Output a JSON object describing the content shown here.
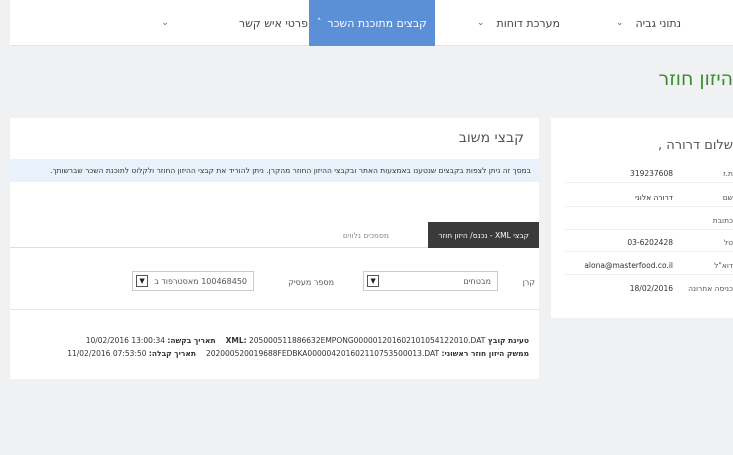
{
  "nav": {
    "items": [
      {
        "label": "נתוני גביה"
      },
      {
        "label": "מערכת דוחות"
      },
      {
        "label": "קבצים מתוכנת השכר"
      },
      {
        "label": "פרטי איש קשר"
      }
    ]
  },
  "page": {
    "title": "היזון חוזר"
  },
  "main": {
    "title": "קבצי משוב",
    "notice": "במסך זה ניתן לצפות בקבצים שנטענו באמצעות האתר ובקבצי ההיזון החוזר מהקרן. ניתן להוריד את קבצי ההיזון החוזר ולקלוט לתוכנת השכר שברשותך.",
    "tabs": {
      "active": "קבצי XML - נכנס/ היזון חוזר",
      "inactive": "מסמכים נלווים"
    },
    "filters": {
      "fund_label": "קרן",
      "fund_value": "מבטחים",
      "employer_label": "מספר מעסיק",
      "employer_value": "100468450 מאסטרפוד ב"
    },
    "records": {
      "row1": {
        "file_label": "טעינת קובץ XML:",
        "file_value": "205000511886632EMPONG000001201602101054122010.DAT",
        "date_label": "תאריך בקשה:",
        "date_value": "13:00:34 10/02/2016"
      },
      "row2": {
        "file_label": "ממשק היזון חוזר ראשוני:",
        "file_value": "202000520019688FEDBKA000004201602110753500013.DAT",
        "date_label": "תאריך קבלה:",
        "date_value": "07:53:50 11/02/2016"
      }
    }
  },
  "profile": {
    "name": "שלום דרורה ,",
    "rows": [
      {
        "label": "ת.ז",
        "value": "319237608"
      },
      {
        "label": "שם",
        "value": "דרורה אלוני"
      },
      {
        "label": "כתובת",
        "value": ""
      },
      {
        "label": "טל",
        "value": "03-6202428"
      },
      {
        "label": "דוא\"ל",
        "value": "alona@masterfood.co.il"
      },
      {
        "label": "כניסה אחרונה",
        "value": "18/02/2016"
      }
    ]
  },
  "colors": {
    "accent": "#5b8fd6",
    "title_green": "#3a8a2e",
    "tab_dark": "#3a3a3a"
  }
}
